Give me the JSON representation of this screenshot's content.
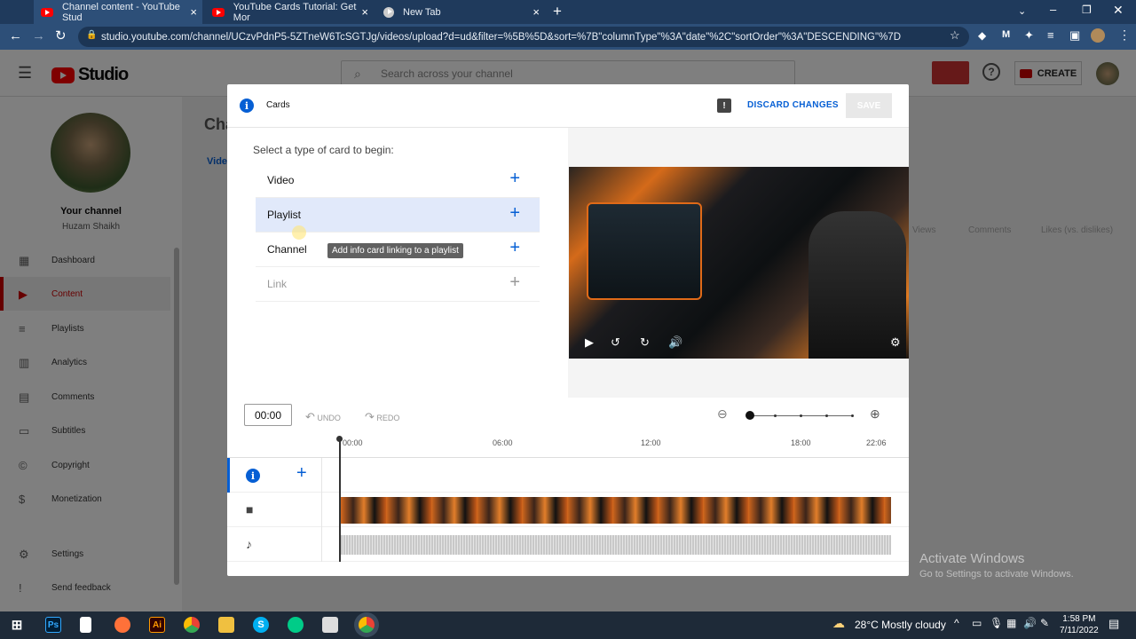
{
  "browser": {
    "tabs": [
      {
        "title": "Channel content - YouTube Stud",
        "close": "×"
      },
      {
        "title": "YouTube Cards Tutorial: Get Mor",
        "close": "×"
      },
      {
        "title": "New Tab",
        "close": "×"
      }
    ],
    "new_tab": "+",
    "url": "studio.youtube.com/channel/UCzvPdnP5-5ZTneW6TcSGTJg/videos/upload?d=ud&filter=%5B%5D&sort=%7B\"columnType\"%3A\"date\"%2C\"sortOrder\"%3A\"DESCENDING\"%7D"
  },
  "header": {
    "logo_text": "Studio",
    "search_placeholder": "Search across your channel",
    "create_label": "CREATE"
  },
  "sidebar": {
    "channel_label": "Your channel",
    "user_name": "Huzam Shaikh",
    "items": [
      {
        "label": "Dashboard",
        "icon": "dashboard-icon"
      },
      {
        "label": "Content",
        "icon": "content-icon"
      },
      {
        "label": "Playlists",
        "icon": "playlists-icon"
      },
      {
        "label": "Analytics",
        "icon": "analytics-icon"
      },
      {
        "label": "Comments",
        "icon": "comments-icon"
      },
      {
        "label": "Subtitles",
        "icon": "subtitles-icon"
      },
      {
        "label": "Copyright",
        "icon": "copyright-icon"
      },
      {
        "label": "Monetization",
        "icon": "monetization-icon"
      },
      {
        "label": "Settings",
        "icon": "settings-icon"
      },
      {
        "label": "Send feedback",
        "icon": "feedback-icon"
      }
    ]
  },
  "background": {
    "page_title": "Cha",
    "tab_partial": "Vide",
    "columns": [
      "Views",
      "Comments",
      "Likes (vs. dislikes)"
    ]
  },
  "modal": {
    "title": "Cards",
    "discard_label": "DISCARD CHANGES",
    "save_label": "SAVE",
    "prompt": "Select a type of card to begin:",
    "card_types": [
      {
        "label": "Video"
      },
      {
        "label": "Playlist"
      },
      {
        "label": "Channel"
      },
      {
        "label": "Link"
      }
    ],
    "tooltip": "Add info card linking to a playlist",
    "timeline": {
      "timecode": "00:00",
      "undo_label": "UNDO",
      "redo_label": "REDO",
      "ticks": [
        "00:00",
        "06:00",
        "12:00",
        "18:00",
        "22:06"
      ]
    }
  },
  "watermark": {
    "line1": "Activate Windows",
    "line2": "Go to Settings to activate Windows."
  },
  "taskbar": {
    "weather": "28°C  Mostly cloudy",
    "time": "1:58 PM",
    "date": "7/11/2022"
  },
  "colors": {
    "accent": "#065fd4",
    "brand": "#ff0000",
    "active_nav": "#cc0000"
  }
}
